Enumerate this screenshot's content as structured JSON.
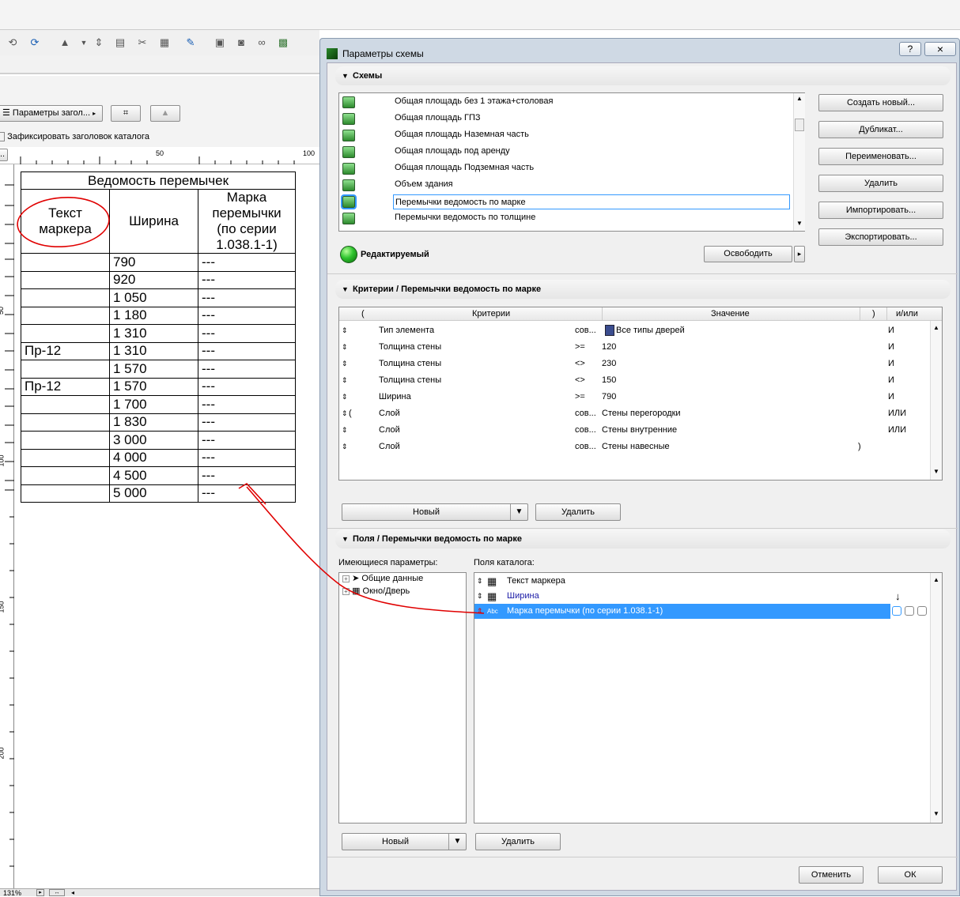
{
  "background": {
    "toolbar_icons": [
      "undo-icon",
      "redo-icon",
      "sort-icon",
      "dropdown-arrow-icon",
      "split-icon",
      "merge-icon",
      "cut-icon",
      "table-icon",
      "brush-icon",
      "frame-icon",
      "camera-icon",
      "binoculars-icon",
      "map-icon"
    ],
    "header_params_button": "Параметры загол...",
    "freeze_header_label": "Зафиксировать заголовок каталога",
    "ruler": {
      "marks": [
        "50",
        "100"
      ],
      "v_marks": [
        "50",
        "100",
        "150",
        "200"
      ]
    },
    "zoom": "131%"
  },
  "schedule": {
    "title": "Ведомость перемычек",
    "headers": [
      "Текст маркера",
      "Ширина",
      "Марка перемычки (по серии 1.038.1-1)"
    ],
    "rows": [
      {
        "marker": "",
        "width": "790",
        "mark": "---"
      },
      {
        "marker": "",
        "width": "920",
        "mark": "---"
      },
      {
        "marker": "",
        "width": "1 050",
        "mark": "---"
      },
      {
        "marker": "",
        "width": "1 180",
        "mark": "---"
      },
      {
        "marker": "",
        "width": "1 310",
        "mark": "---"
      },
      {
        "marker": "Пр-12",
        "width": "1 310",
        "mark": "---"
      },
      {
        "marker": "",
        "width": "1 570",
        "mark": "---"
      },
      {
        "marker": "Пр-12",
        "width": "1 570",
        "mark": "---"
      },
      {
        "marker": "",
        "width": "1 700",
        "mark": "---"
      },
      {
        "marker": "",
        "width": "1 830",
        "mark": "---"
      },
      {
        "marker": "",
        "width": "3 000",
        "mark": "---"
      },
      {
        "marker": "",
        "width": "4 000",
        "mark": "---"
      },
      {
        "marker": "",
        "width": "4 500",
        "mark": "---"
      },
      {
        "marker": "",
        "width": "5 000",
        "mark": "---"
      }
    ]
  },
  "dialog": {
    "title": "Параметры схемы",
    "help": "?",
    "close": "×",
    "schemes": {
      "section": "Схемы",
      "items": [
        "Общая площадь без 1 этажа+столовая",
        "Общая площадь ГПЗ",
        "Общая площадь Наземная часть",
        "Общая площадь под аренду",
        "Общая площадь Подземная часть",
        "Объем здания",
        "Перемычки ведомость по марке",
        "Перемычки ведомость по толщине"
      ],
      "selected_index": 6,
      "buttons": [
        "Создать новый...",
        "Дубликат...",
        "Переименовать...",
        "Удалить",
        "Импортировать...",
        "Экспортировать..."
      ],
      "status": "Редактируемый",
      "release": "Освободить"
    },
    "criteria": {
      "section": "Критерии /  Перемычки ведомость по марке",
      "columns": [
        "(",
        "Критерии",
        "Значение",
        ")",
        "и/или"
      ],
      "rows": [
        {
          "open": "",
          "name": "Тип элемента",
          "op": "сов...",
          "value": "Все типы дверей",
          "close": "",
          "andor": "И",
          "icon": "door-icon"
        },
        {
          "open": "",
          "name": "Толщина стены",
          "op": ">=",
          "value": "120",
          "close": "",
          "andor": "И"
        },
        {
          "open": "",
          "name": "Толщина стены",
          "op": "<>",
          "value": "230",
          "close": "",
          "andor": "И"
        },
        {
          "open": "",
          "name": "Толщина стены",
          "op": "<>",
          "value": "150",
          "close": "",
          "andor": "И"
        },
        {
          "open": "",
          "name": "Ширина",
          "op": ">=",
          "value": "790",
          "close": "",
          "andor": "И"
        },
        {
          "open": "(",
          "name": "Слой",
          "op": "сов...",
          "value": "Стены перегородки",
          "close": "",
          "andor": "ИЛИ"
        },
        {
          "open": "",
          "name": "Слой",
          "op": "сов...",
          "value": "Стены внутренние",
          "close": "",
          "andor": "ИЛИ"
        },
        {
          "open": "",
          "name": "Слой",
          "op": "сов...",
          "value": "Стены навесные",
          "close": ")",
          "andor": ""
        }
      ],
      "new": "Новый",
      "delete": "Удалить"
    },
    "fields": {
      "section": "Поля /  Перемычки ведомость по марке",
      "available_label": "Имеющиеся параметры:",
      "catalog_label": "Поля каталога:",
      "tree": [
        "Общие данные",
        "Окно/Дверь"
      ],
      "catalog": [
        {
          "label": "Текст маркера",
          "icon": "grid-icon",
          "color": "#000000"
        },
        {
          "label": "Ширина",
          "icon": "grid-icon",
          "color": "#1a1aa6"
        },
        {
          "label": "Марка перемычки (по серии 1.038.1-1)",
          "icon": "Abc",
          "color": "#ffffff"
        }
      ],
      "new": "Новый",
      "delete": "Удалить"
    },
    "cancel": "Отменить",
    "ok": "ОК"
  },
  "colors": {
    "selection": "#3399ff",
    "annotation": "#e00000",
    "status_green": "#2ec42e"
  }
}
